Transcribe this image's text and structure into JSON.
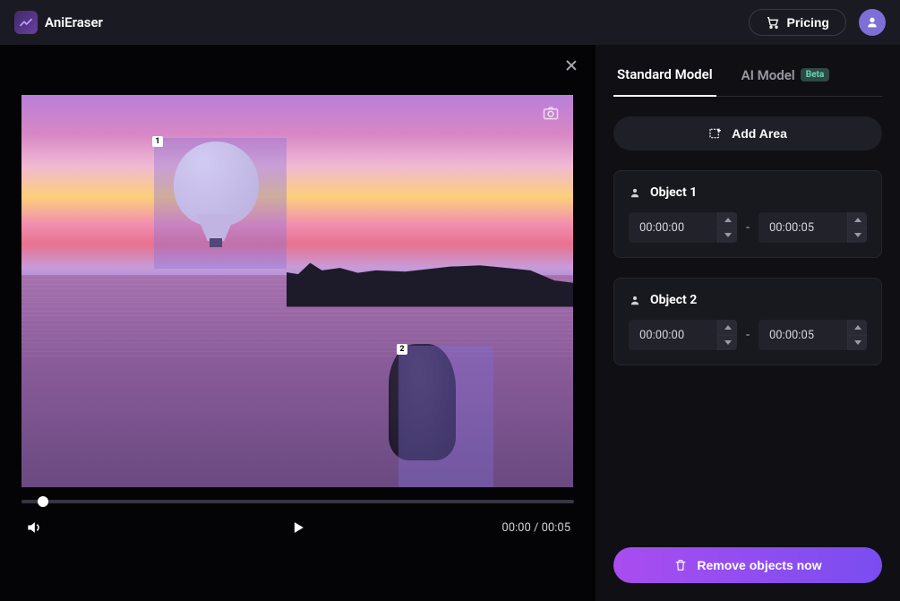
{
  "header": {
    "brand": "AniEraser",
    "pricing_label": "Pricing"
  },
  "tabs": {
    "standard": "Standard Model",
    "ai": "AI Model",
    "beta_badge": "Beta"
  },
  "sidebar": {
    "add_area_label": "Add Area",
    "remove_label": "Remove objects now"
  },
  "objects": [
    {
      "title": "Object 1",
      "badge": "1",
      "start": "00:00:00",
      "end": "00:00:05"
    },
    {
      "title": "Object 2",
      "badge": "2",
      "start": "00:00:00",
      "end": "00:00:05"
    }
  ],
  "playback": {
    "current": "00:00",
    "total": "00:05"
  }
}
